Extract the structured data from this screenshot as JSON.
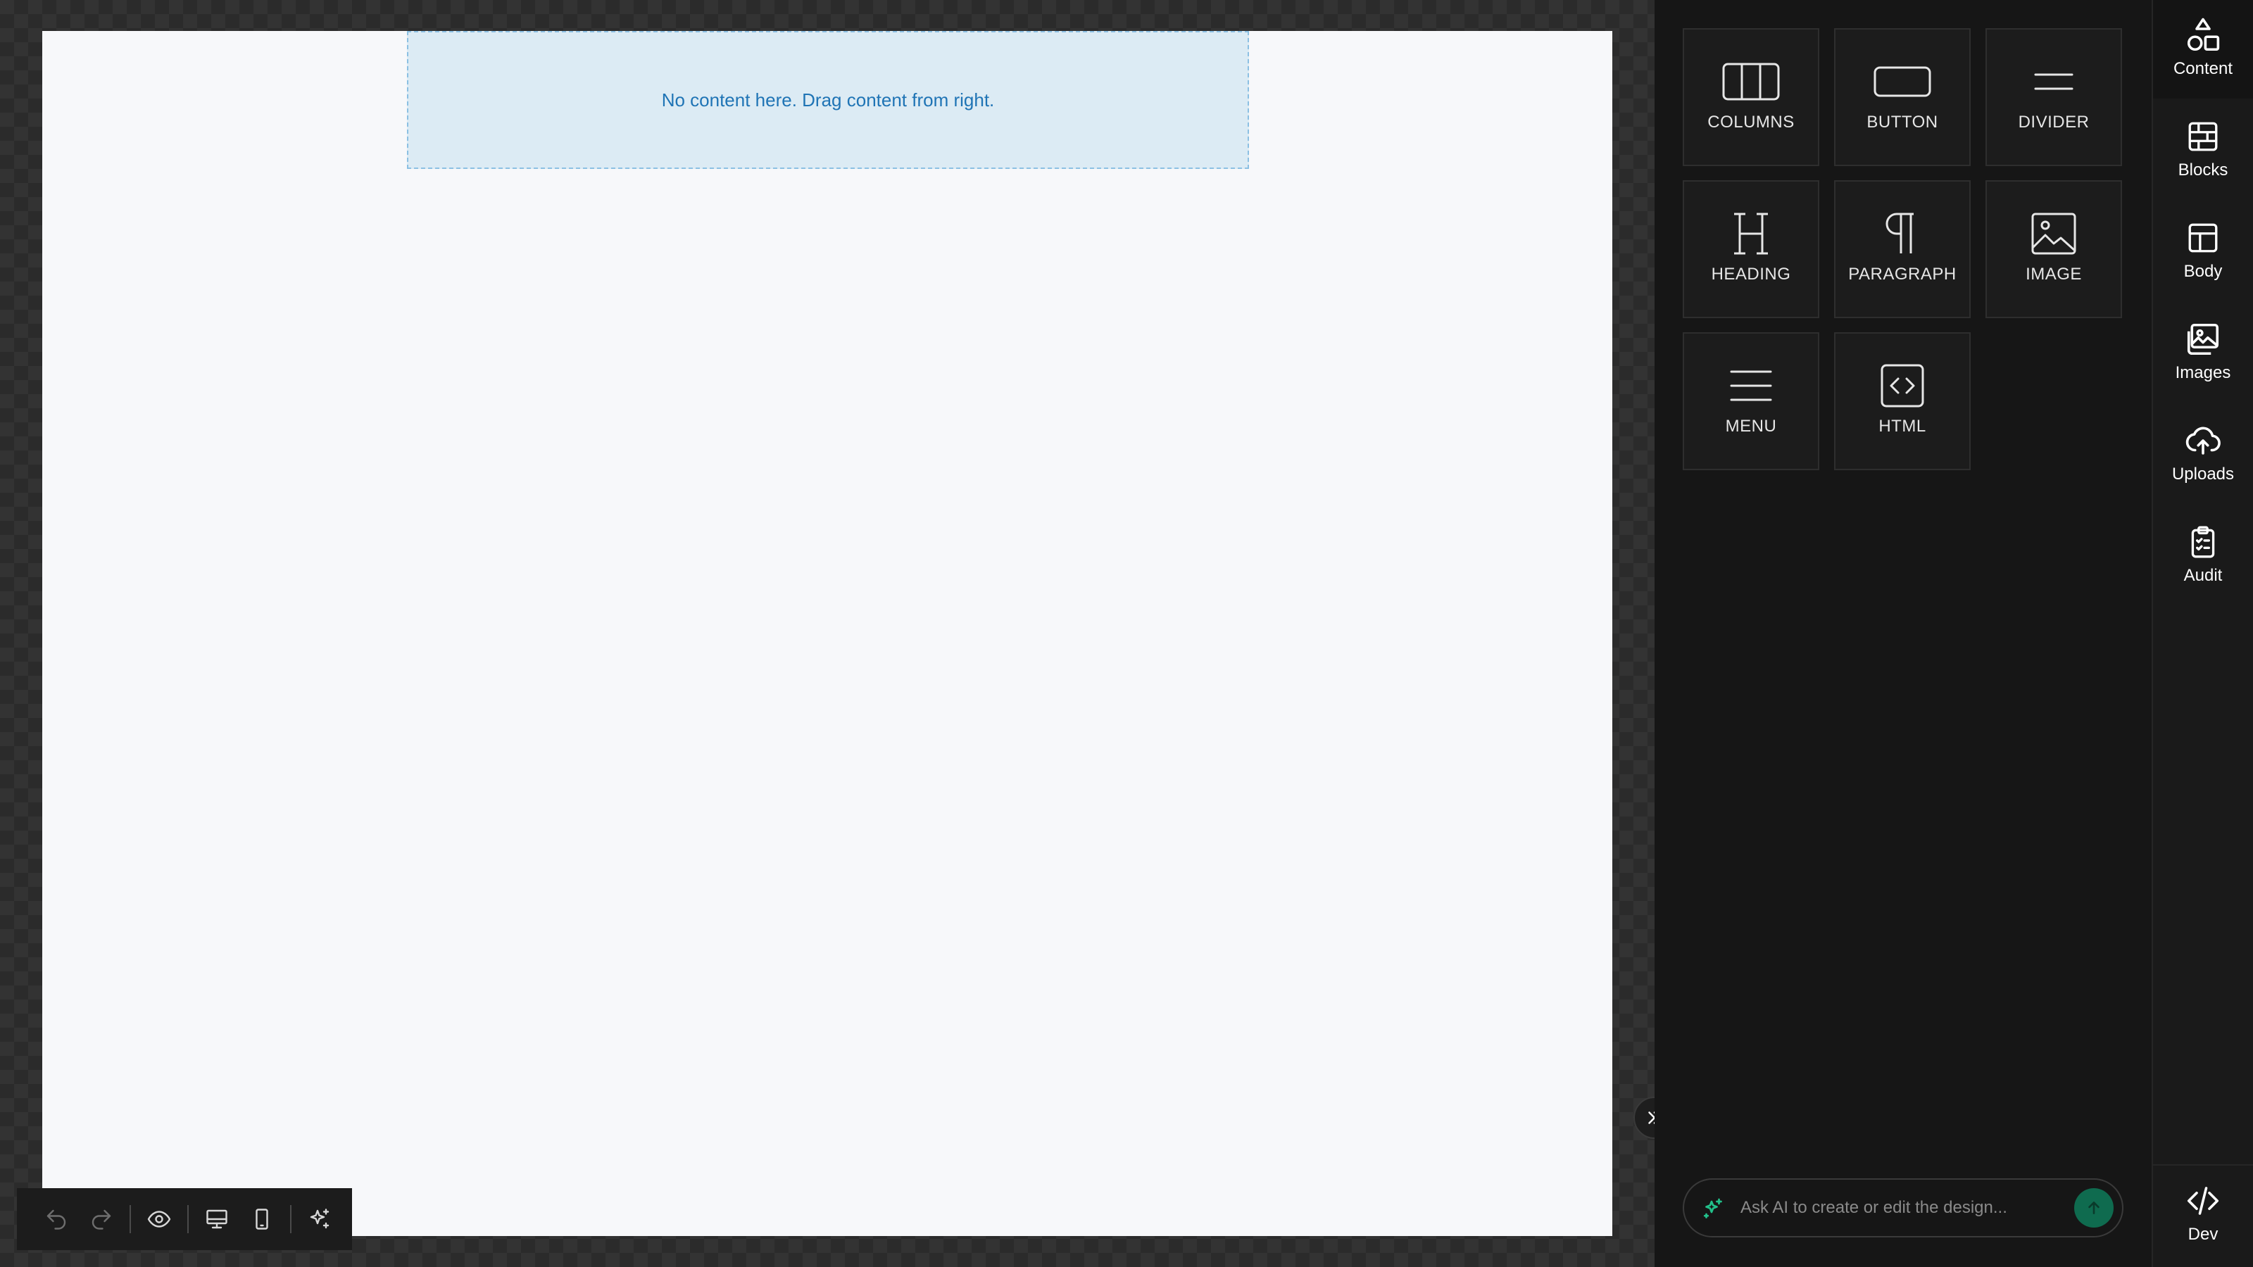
{
  "canvas": {
    "empty_message": "No content here. Drag content from right."
  },
  "toolbar": {
    "items": [
      {
        "name": "undo-icon"
      },
      {
        "name": "redo-icon"
      },
      {
        "name": "preview-eye-icon"
      },
      {
        "name": "desktop-view-icon"
      },
      {
        "name": "mobile-view-icon"
      },
      {
        "name": "ai-sparkle-icon"
      }
    ]
  },
  "panel": {
    "tiles": [
      {
        "label": "COLUMNS",
        "icon": "columns-icon"
      },
      {
        "label": "BUTTON",
        "icon": "button-icon"
      },
      {
        "label": "DIVIDER",
        "icon": "divider-icon"
      },
      {
        "label": "HEADING",
        "icon": "heading-icon"
      },
      {
        "label": "PARAGRAPH",
        "icon": "paragraph-icon"
      },
      {
        "label": "IMAGE",
        "icon": "image-icon"
      },
      {
        "label": "MENU",
        "icon": "menu-icon"
      },
      {
        "label": "HTML",
        "icon": "html-icon"
      }
    ],
    "ai_bar": {
      "placeholder": "Ask AI to create or edit the design..."
    }
  },
  "rail": {
    "items": [
      {
        "label": "Content",
        "icon": "shapes-icon",
        "active": true
      },
      {
        "label": "Blocks",
        "icon": "blocks-icon"
      },
      {
        "label": "Body",
        "icon": "layout-icon"
      },
      {
        "label": "Images",
        "icon": "images-icon"
      },
      {
        "label": "Uploads",
        "icon": "cloud-upload-icon"
      },
      {
        "label": "Audit",
        "icon": "clipboard-icon"
      },
      {
        "label": "Dev",
        "icon": "code-icon"
      }
    ]
  },
  "colors": {
    "panel_bg": "#161616",
    "canvas_bg": "#f7f8fa",
    "drop_zone_bg": "#dcebf4",
    "drop_zone_text": "#1f74b5",
    "send_button": "#0f6b4f"
  }
}
